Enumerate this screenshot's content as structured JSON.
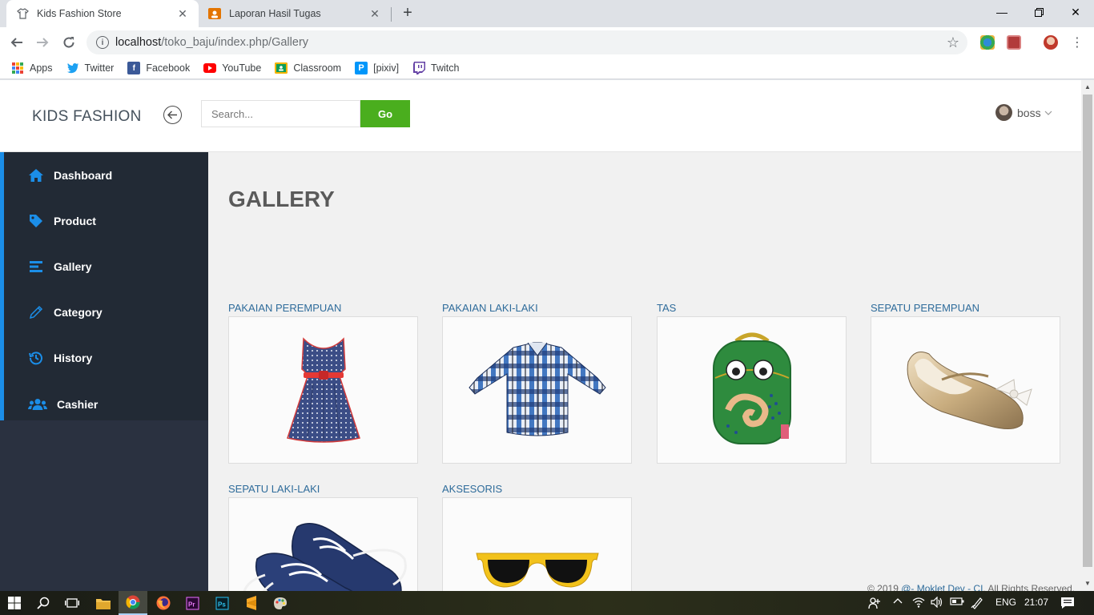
{
  "browser": {
    "tabs": [
      {
        "title": "Kids Fashion Store",
        "active": true
      },
      {
        "title": "Laporan Hasil Tugas",
        "active": false
      }
    ],
    "url_host": "localhost",
    "url_path": "/toko_baju/index.php/Gallery",
    "bookmarks": [
      {
        "label": "Apps",
        "icon": "apps-grid-icon"
      },
      {
        "label": "Twitter",
        "icon": "twitter-icon"
      },
      {
        "label": "Facebook",
        "icon": "facebook-icon"
      },
      {
        "label": "YouTube",
        "icon": "youtube-icon"
      },
      {
        "label": "Classroom",
        "icon": "classroom-icon"
      },
      {
        "label": "[pixiv]",
        "icon": "pixiv-icon"
      },
      {
        "label": "Twitch",
        "icon": "twitch-icon"
      }
    ]
  },
  "header": {
    "brand": "KIDS FASHION",
    "search_placeholder": "Search...",
    "go_label": "Go",
    "username": "boss"
  },
  "sidebar": {
    "items": [
      {
        "label": "Dashboard",
        "icon": "home-icon"
      },
      {
        "label": "Product",
        "icon": "tag-icon"
      },
      {
        "label": "Gallery",
        "icon": "list-icon"
      },
      {
        "label": "Category",
        "icon": "pencil-icon"
      },
      {
        "label": "History",
        "icon": "history-icon"
      },
      {
        "label": "Cashier",
        "icon": "users-icon"
      }
    ]
  },
  "main": {
    "title": "GALLERY",
    "gallery": [
      {
        "label": "PAKAIAN PEREMPUAN",
        "image": "girl-dress"
      },
      {
        "label": "PAKAIAN LAKI-LAKI",
        "image": "boy-plaid-shirt"
      },
      {
        "label": "TAS",
        "image": "kids-backpack"
      },
      {
        "label": "SEPATU PEREMPUAN",
        "image": "girl-shoe"
      },
      {
        "label": "SEPATU LAKI-LAKI",
        "image": "boy-sneakers"
      },
      {
        "label": "AKSESORIS",
        "image": "sunglasses"
      }
    ]
  },
  "footer": {
    "prefix": "© 2019 ",
    "link": "@- Moklet Dev - CI",
    "suffix": ". All Rights Reserved."
  },
  "taskbar": {
    "language": "ENG",
    "time": "21:07"
  },
  "colors": {
    "accent_blue": "#1b8ee8",
    "go_green": "#4aae1e",
    "sidebar_bg": "#222a35",
    "label_blue": "#2f6c9b"
  }
}
